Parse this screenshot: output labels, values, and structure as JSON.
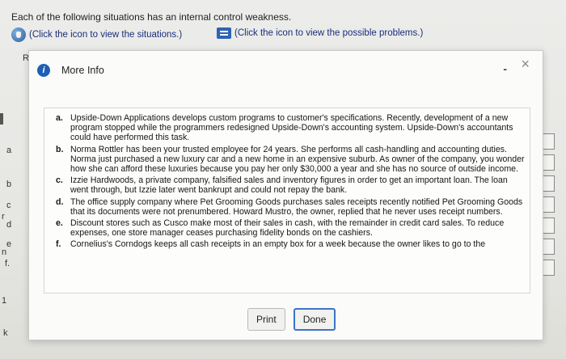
{
  "page": {
    "instruction": "Each of the following situations has an internal control weakness.",
    "link_situations": "(Click the icon to view the situations.)",
    "link_problems": "(Click the icon to view the possible problems.)",
    "background_fragments": [
      "R",
      "a",
      "b",
      "c",
      "d",
      "e",
      "f.",
      "r",
      "n",
      "k",
      "1"
    ]
  },
  "modal": {
    "title": "More Info",
    "minimize_label": "-",
    "close_label": "×",
    "items": [
      {
        "marker": "a.",
        "text": "Upside-Down Applications develops custom programs to customer's specifications. Recently, development of a new program stopped while the programmers redesigned Upside-Down's accounting system. Upside-Down's accountants could have performed this task."
      },
      {
        "marker": "b.",
        "text": "Norma Rottler has been your trusted employee for 24 years. She performs all cash-handling and accounting duties. Norma just purchased a new luxury car and a new home in an expensive suburb. As owner of the company, you wonder how she can afford these luxuries because you pay her only $30,000 a year and she has no source of outside income."
      },
      {
        "marker": "c.",
        "text": "Izzie Hardwoods, a private company, falsified sales and inventory figures in order to get an important loan. The loan went through, but Izzie later went bankrupt and could not repay the bank."
      },
      {
        "marker": "d.",
        "text": "The office supply company where Pet Grooming Goods purchases sales receipts recently notified Pet Grooming Goods that its documents were not prenumbered. Howard Mustro, the owner, replied that he never uses receipt numbers."
      },
      {
        "marker": "e.",
        "text": "Discount stores such as Cusco make most of their sales in cash, with the remainder in credit card sales. To reduce expenses, one store manager ceases purchasing fidelity bonds on the cashiers."
      },
      {
        "marker": "f.",
        "text": "Cornelius's Corndogs keeps all cash receipts in an empty box for a week because the owner likes to go to the"
      }
    ],
    "print_label": "Print",
    "done_label": "Done"
  }
}
